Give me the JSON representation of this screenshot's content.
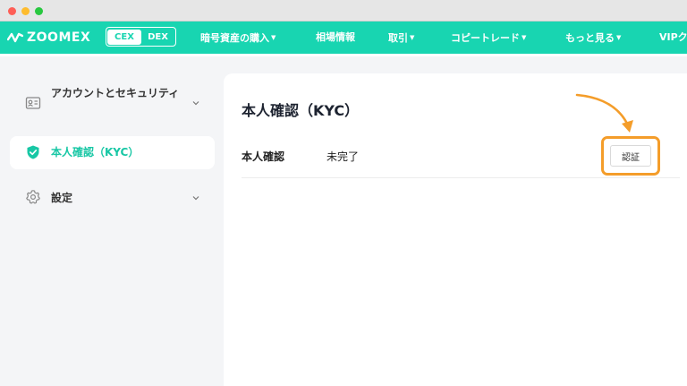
{
  "colors": {
    "brand": "#18d5b1",
    "accent_text": "#18c7a5",
    "highlight": "#f49d2a"
  },
  "window": {
    "controls": [
      "close",
      "minimize",
      "zoom"
    ]
  },
  "header": {
    "logo_text": "ZOOMEX",
    "switch": {
      "cex": "CEX",
      "dex": "DEX"
    },
    "nav": [
      {
        "label": "暗号資産の購入",
        "dropdown": true
      },
      {
        "label": "相場情報",
        "dropdown": false
      },
      {
        "label": "取引",
        "dropdown": true
      },
      {
        "label": "コピートレード",
        "dropdown": true
      },
      {
        "label": "もっと見る",
        "dropdown": true
      },
      {
        "label": "VIPク",
        "dropdown": false
      }
    ]
  },
  "sidebar": {
    "items": [
      {
        "label": "アカウントとセキュリティ",
        "icon": "id-card-icon",
        "expandable": true,
        "active": false
      },
      {
        "label": "本人確認（KYC）",
        "icon": "shield-check-icon",
        "expandable": false,
        "active": true
      },
      {
        "label": "設定",
        "icon": "gear-icon",
        "expandable": true,
        "active": false
      }
    ]
  },
  "main": {
    "title": "本人確認（KYC）",
    "row": {
      "label": "本人確認",
      "status": "未完了",
      "action_label": "認証"
    }
  }
}
